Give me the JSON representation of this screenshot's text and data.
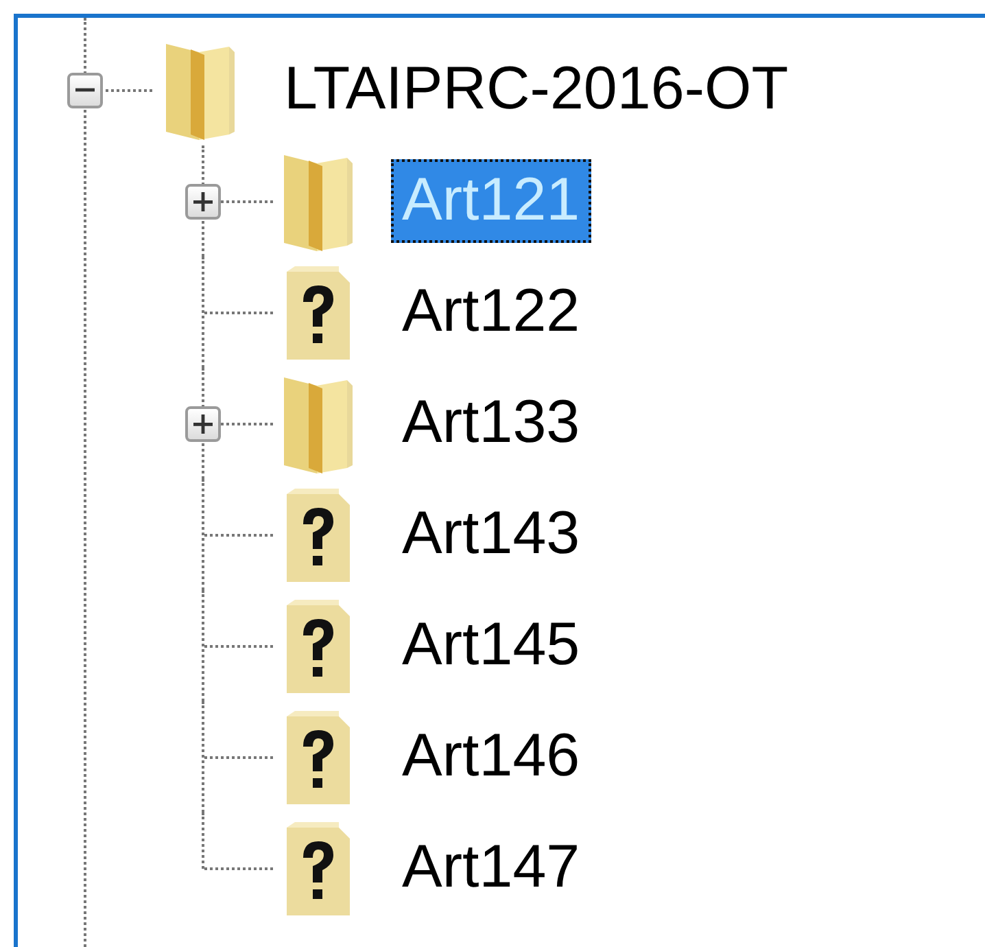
{
  "tree": {
    "root": {
      "label": "LTAIPRC-2016-OT",
      "kind": "folder",
      "expanded": true,
      "selected": false,
      "children": [
        {
          "label": "Art121",
          "kind": "folder",
          "expanded": false,
          "selected": true
        },
        {
          "label": "Art122",
          "kind": "unknown",
          "selected": false
        },
        {
          "label": "Art133",
          "kind": "folder",
          "expanded": false,
          "selected": false
        },
        {
          "label": "Art143",
          "kind": "unknown",
          "selected": false
        },
        {
          "label": "Art145",
          "kind": "unknown",
          "selected": false
        },
        {
          "label": "Art146",
          "kind": "unknown",
          "selected": false
        },
        {
          "label": "Art147",
          "kind": "unknown",
          "selected": false
        }
      ]
    }
  }
}
